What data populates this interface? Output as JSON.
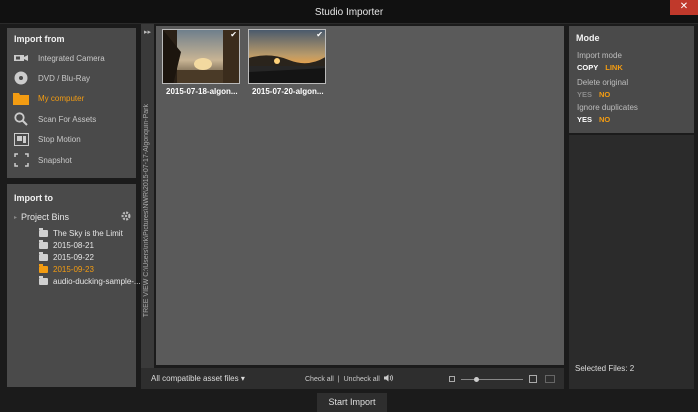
{
  "window": {
    "title": "Studio Importer",
    "close_label": "✕"
  },
  "import_from": {
    "heading": "Import from",
    "items": [
      {
        "label": "Integrated Camera",
        "icon": "camera-icon"
      },
      {
        "label": "DVD / Blu-Ray",
        "icon": "disc-icon"
      },
      {
        "label": "My computer",
        "icon": "folder-icon",
        "active": true
      },
      {
        "label": "Scan For Assets",
        "icon": "search-icon"
      },
      {
        "label": "Stop Motion",
        "icon": "stop-motion-icon"
      },
      {
        "label": "Snapshot",
        "icon": "snapshot-icon"
      }
    ]
  },
  "import_to": {
    "heading": "Import to",
    "root": "Project Bins",
    "bins": [
      {
        "label": "The Sky is the Limit"
      },
      {
        "label": "2015-08-21"
      },
      {
        "label": "2015-09-22"
      },
      {
        "label": "2015-09-23",
        "active": true
      },
      {
        "label": "audio-ducking-sample-..."
      }
    ]
  },
  "tree_view": {
    "expand_glyph": "▸▸",
    "path": "TREE VIEW C:\\Users\\nrk\\Pictures\\NWR\\2015-07-17-Algonquin-Park"
  },
  "browser": {
    "thumbnails": [
      {
        "label": "2015-07-18-algon...",
        "checked": true
      },
      {
        "label": "2015-07-20-algon...",
        "checked": true
      }
    ],
    "filter_label": "All compatible asset files ▾",
    "check_all": "Check all",
    "separator": "|",
    "uncheck_all": "Uncheck all",
    "zoom_level": 0.25
  },
  "mode": {
    "heading": "Mode",
    "import_mode": {
      "label": "Import mode",
      "options": [
        "COPY",
        "LINK"
      ],
      "selected": "LINK"
    },
    "delete_original": {
      "label": "Delete original",
      "options": [
        "YES",
        "NO"
      ],
      "selected": "NO"
    },
    "ignore_duplicates": {
      "label": "Ignore duplicates",
      "options": [
        "YES",
        "NO"
      ],
      "selected": "NO"
    }
  },
  "selected_files": "Selected Files: 2",
  "start_import": "Start Import",
  "colors": {
    "accent": "#f39c12",
    "close": "#c0392b",
    "panel": "#4a4a4a",
    "browser_bg": "#5a5a5a"
  }
}
